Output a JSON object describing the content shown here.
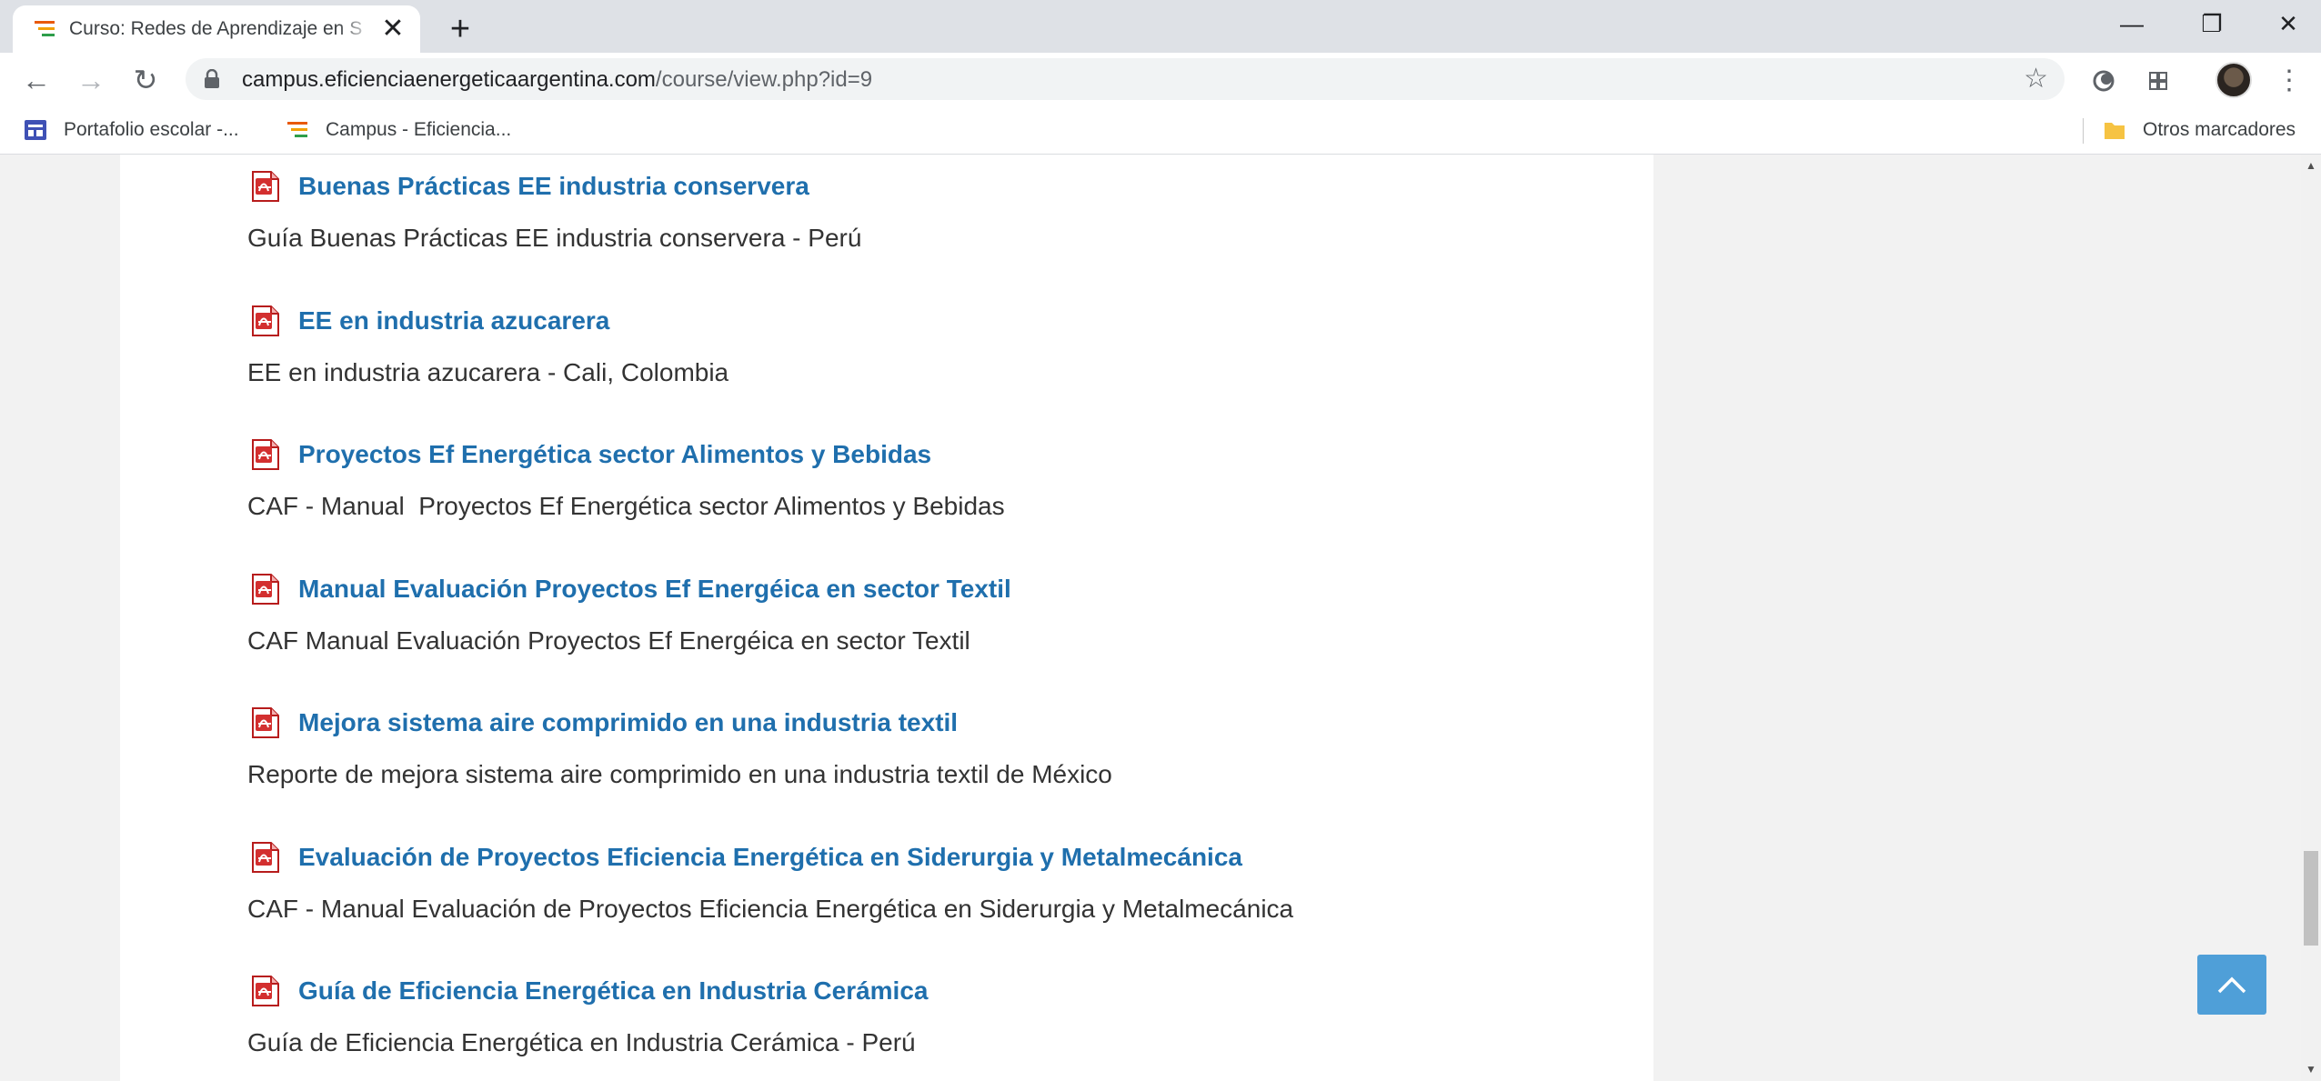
{
  "browser": {
    "tab": {
      "title": "Curso: Redes de Aprendizaje en S",
      "close": "✕"
    },
    "new_tab": "+",
    "window_controls": {
      "minimize": "—",
      "restore": "❐",
      "close": "✕"
    },
    "nav": {
      "back": "←",
      "forward": "→",
      "reload": "↻"
    },
    "url": {
      "host": "campus.eficienciaenergeticaargentina.com",
      "path": "/course/view.php?id=9"
    },
    "star": "☆",
    "menu": "⋮",
    "bookmarks": [
      {
        "label": "Portafolio escolar -..."
      },
      {
        "label": "Campus - Eficiencia..."
      }
    ],
    "other_bookmarks": "Otros marcadores"
  },
  "activities": [
    {
      "title": "Buenas Prácticas EE industria conservera",
      "description": "Guía Buenas Prácticas EE industria conservera - Perú"
    },
    {
      "title": "EE en industria azucarera",
      "description": "EE en industria azucarera - Cali, Colombia"
    },
    {
      "title": "Proyectos Ef Energética sector Alimentos y Bebidas",
      "description": "CAF - Manual  Proyectos Ef Energética sector Alimentos y Bebidas"
    },
    {
      "title": "Manual Evaluación Proyectos Ef Energéica en sector Textil",
      "description": "CAF Manual Evaluación Proyectos Ef Energéica en sector Textil"
    },
    {
      "title": "Mejora sistema aire comprimido en una industria textil",
      "description": "Reporte de mejora sistema aire comprimido en una industria textil de México"
    },
    {
      "title": "Evaluación de Proyectos Eficiencia Energética en Siderurgia y Metalmecánica",
      "description": "CAF - Manual Evaluación de Proyectos Eficiencia Energética en Siderurgia y Metalmecánica"
    },
    {
      "title": "Guía de Eficiencia Energética en Industria Cerámica",
      "description": "Guía de Eficiencia Energética en Industria Cerámica - Perú"
    }
  ],
  "colors": {
    "link": "#1f6fad",
    "back_to_top": "#4f9fd8",
    "pdf_red": "#d32f2f"
  }
}
